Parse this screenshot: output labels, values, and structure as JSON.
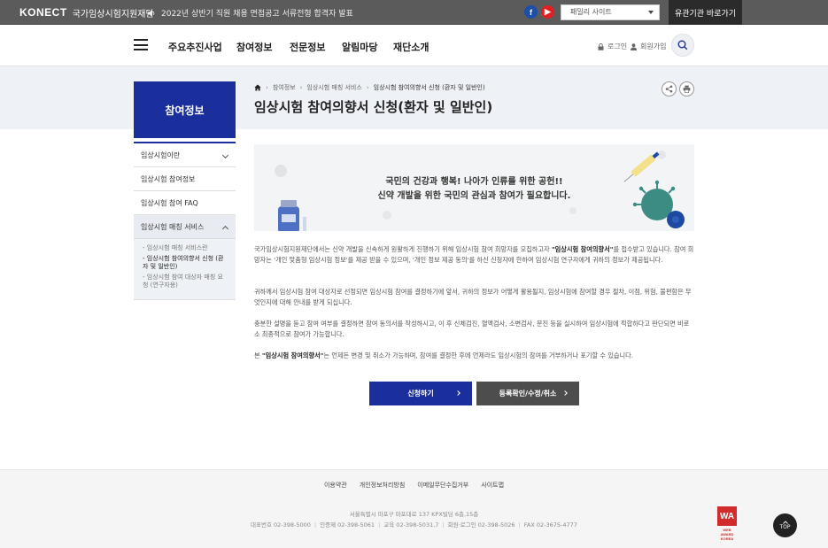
{
  "header": {
    "logo_mark": "KONECT",
    "org_name": "국가임상시험지원재단",
    "notice": "2022년 상반기 직원 채용 면접공고 서류전형 합격자 발표",
    "sns_facebook": "f",
    "sns_youtube": "▶",
    "family_site": "패밀리 사이트",
    "shortcut": "유관기관 바로가기"
  },
  "nav": {
    "items": [
      "주요추진사업",
      "참여정보",
      "전문정보",
      "알림마당",
      "재단소개"
    ],
    "login": "로그인",
    "join": "회원가입"
  },
  "sidebar": {
    "title": "참여정보",
    "items": [
      {
        "label": "임상시험이란"
      },
      {
        "label": "임상시험 참여정보"
      },
      {
        "label": "임상시험 참여 FAQ"
      },
      {
        "label": "임상시험 매칭 서비스"
      }
    ],
    "sub_items": [
      {
        "label": "- 임상시험 매칭 서비스란"
      },
      {
        "label": "- 임상시험 참여의향서 신청 (환자 및 일반인)"
      },
      {
        "label": "- 임상시험 참여 대상자 매칭 요청 (연구자용)"
      }
    ]
  },
  "breadcrumb": {
    "items": [
      "참여정보",
      "임상시험 매칭 서비스",
      "임상시험 참여의향서 신청 (환자 및 일반인)"
    ]
  },
  "page": {
    "title": "임상시험 참여의향서 신청(환자 및 일반인)"
  },
  "banner": {
    "line1": "국민의 건강과 행복! 나아가 인류를 위한 공헌!!",
    "line2": "신약 개발을 위한 국민의 관심과 참여가 필요합니다."
  },
  "body": {
    "p1_a": "국가임상시험지원재단에서는 신약 개발을 신속하게 원활하게 진행하기 위해 임상시험 참여 희망자를 모집하고자 ",
    "p1_b": "\"임상시험 참여의향서\"",
    "p1_c": "를 접수받고 있습니다. 참여 희망자는 '개인 맞춤형 임상시험 정보'를 제공 받을 수 있으며, '개인 정보 제공 동의'를 하신 신청자에 한하여 임상시험 연구자에게 귀하의 정보가 제공됩니다.",
    "p2": "귀하께서 임상시험 참여 대상자로 선정되면 임상시험 참여를 결정하기에 앞서, 귀하의 정보가 어떻게 활용될지, 임상시험에 참여할 경우 절차, 이점, 위험, 불편함은 무엇인지에 대해 안내를 받게 되십니다.",
    "p3": "충분한 설명을 듣고 참여 여부를 결정하면 참여 동의서를 작성하시고, 이 후 신체검진, 혈액검사, 소변검사, 문진 등을 실시하여 임상시험에 적합하다고 판단되면 비로소 최종적으로 참여가 가능합니다.",
    "p4_a": "본 ",
    "p4_b": "\"임상시험 참여의향서\"",
    "p4_c": "는 언제든 변경 및 취소가 가능하며, 참여를 결정한 후에 언제라도 임상시험의 참여를 거부하거나 포기할 수 있습니다."
  },
  "buttons": {
    "apply": "신청하기",
    "check": "등록확인/수정/취소"
  },
  "footer": {
    "links": [
      "이용약관",
      "개인정보처리방침",
      "이메일무단수집거부",
      "사이트맵"
    ],
    "address": "서울특별시 마포구 마포대로 137 KPX빌딩 6층,15층",
    "contacts": [
      "대표번호 02-398-5000",
      "인증제 02-398-5061",
      "교육 02-398-5031,7",
      "회원·로그인 02-398-5026",
      "FAX 02-3675-4777"
    ],
    "award_mark": "WA",
    "award_text": "WEB AWARD KOREA",
    "top": "TOP"
  },
  "colors": {
    "brand_blue": "#1a2e9c",
    "topbar": "#5b5b5b",
    "dark_button": "#4d4d4d"
  }
}
